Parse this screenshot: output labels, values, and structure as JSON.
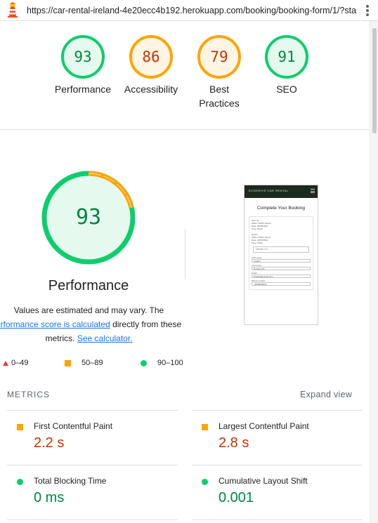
{
  "browser": {
    "url": "https://car-rental-ireland-4e20ecc4b192.herokuapp.com/booking/booking-form/1/?star..."
  },
  "colors": {
    "pass": "#0cce6b",
    "pass_text": "#018642",
    "average": "#ffa400",
    "average_text": "#c33300",
    "fail": "#ff4e42",
    "link": "#1a73e8"
  },
  "gauges": [
    {
      "label": "Performance",
      "score": 93,
      "status": "pass"
    },
    {
      "label": "Accessibility",
      "score": 86,
      "status": "average"
    },
    {
      "label": "Best Practices",
      "score": 79,
      "status": "average"
    },
    {
      "label": "SEO",
      "score": 91,
      "status": "pass"
    }
  ],
  "main_gauge": {
    "score": 93,
    "title": "Performance",
    "estimate_line1": "Values are estimated and may vary. The",
    "perf_link": "erformance score is calculated",
    "estimate_mid": " directly from these",
    "estimate_line3a": "metrics. ",
    "calc_link": "See calculator."
  },
  "legend": {
    "fail": "0–49",
    "average": "50–89",
    "pass": "90–100"
  },
  "thumbnail": {
    "logo": "ECODRIVE CAR RENTAL",
    "title": "Complete Your Booking",
    "pickup_heading": "Pick Up",
    "pickup_office": "Office:     Dublin Airport",
    "pickup_date": "Date:      05/05/2024",
    "pickup_time": "Time:      09:00",
    "return_heading": "Return",
    "return_office": "Office:     Dublin Airport",
    "return_date": "Date:      15/05/2024",
    "return_time": "Time:      09:00",
    "car_select": "Citroen C3",
    "first_name_label": "First name",
    "first_name_value": "Charlie",
    "last_name_label": "Last name",
    "last_name_value": "Rosario-Mo",
    "email_label": "Email",
    "email_value": "cfrdb2@hotmail.com",
    "phone_label": "Phone number",
    "phone_value": "+3538000001"
  },
  "metrics": {
    "heading": "METRICS",
    "expand_label": "Expand view",
    "items": [
      {
        "name": "First Contentful Paint",
        "value": "2.2 s",
        "status": "average"
      },
      {
        "name": "Largest Contentful Paint",
        "value": "2.8 s",
        "status": "average"
      },
      {
        "name": "Total Blocking Time",
        "value": "0 ms",
        "status": "pass"
      },
      {
        "name": "Cumulative Layout Shift",
        "value": "0.001",
        "status": "pass"
      }
    ]
  }
}
